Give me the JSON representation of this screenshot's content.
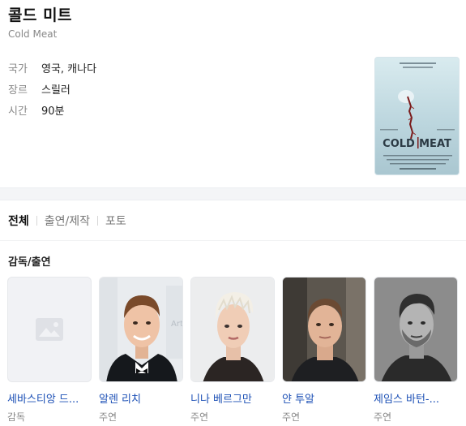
{
  "movie": {
    "title": "콜드 미트",
    "original_title": "Cold Meat",
    "info": [
      {
        "key": "국가",
        "value": "영국, 캐나다"
      },
      {
        "key": "장르",
        "value": "스릴러"
      },
      {
        "key": "시간",
        "value": "90분"
      }
    ],
    "poster": {
      "title_left": "COLD",
      "title_right": "MEAT"
    }
  },
  "tabs": [
    {
      "label": "전체",
      "active": true
    },
    {
      "label": "출연/제작",
      "active": false
    },
    {
      "label": "포토",
      "active": false
    }
  ],
  "cast_section": {
    "title": "감독/출연",
    "people": [
      {
        "name": "세바스티앙 드...",
        "role": "감독",
        "photo": "placeholder-image-icon"
      },
      {
        "name": "알렌 리치",
        "role": "주연",
        "photo": "man-tuxedo"
      },
      {
        "name": "니나 베르그만",
        "role": "주연",
        "photo": "woman-short-blonde-hair"
      },
      {
        "name": "얀 투알",
        "role": "주연",
        "photo": "man-dark-tshirt"
      },
      {
        "name": "제임스 바턴-...",
        "role": "주연",
        "photo": "man-bw-portrait"
      }
    ]
  },
  "colors": {
    "link": "#1b4fb5",
    "muted": "#888888",
    "gap": "#f4f5f7"
  }
}
